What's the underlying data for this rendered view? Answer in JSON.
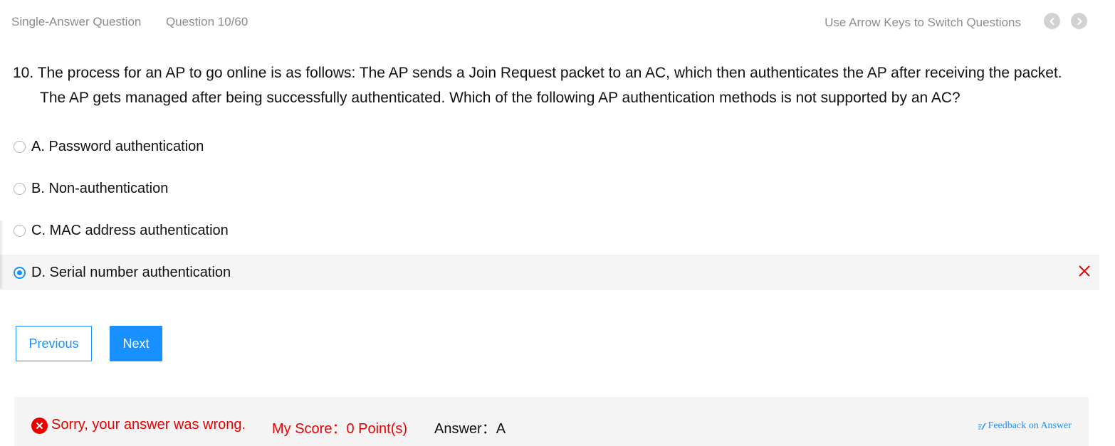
{
  "header": {
    "question_type": "Single-Answer Question",
    "question_counter": "Question 10/60",
    "hint": "Use Arrow Keys to Switch Questions",
    "prev_icon": "chevron-left-icon",
    "next_icon": "chevron-right-icon"
  },
  "question": {
    "text": "10. The process for an AP to go online is as follows: The AP sends a Join Request packet to an AC, which then authenticates the AP after receiving the packet. The AP gets managed after being successfully authenticated. Which of the following AP authentication methods is not supported by an AC?"
  },
  "options": [
    {
      "label": "A. Password authentication",
      "selected": false
    },
    {
      "label": "B. Non-authentication",
      "selected": false
    },
    {
      "label": "C. MAC address authentication",
      "selected": false
    },
    {
      "label": "D. Serial number authentication",
      "selected": true,
      "marked_wrong": true
    }
  ],
  "buttons": {
    "previous": "Previous",
    "next": "Next"
  },
  "result": {
    "message": "Sorry, your answer was wrong.",
    "score": "My Score：0 Point(s)",
    "answer": "Answer：A",
    "feedback": "Feedback on Answer",
    "status_icon": "error-circle-icon",
    "feedback_icon": "edit-icon"
  },
  "colors": {
    "accent": "#1890ff",
    "error": "#e60000",
    "muted_text": "#8c8c8c",
    "selected_row_bg": "#f5f5f5",
    "result_bar_bg": "#f4f4f4"
  }
}
